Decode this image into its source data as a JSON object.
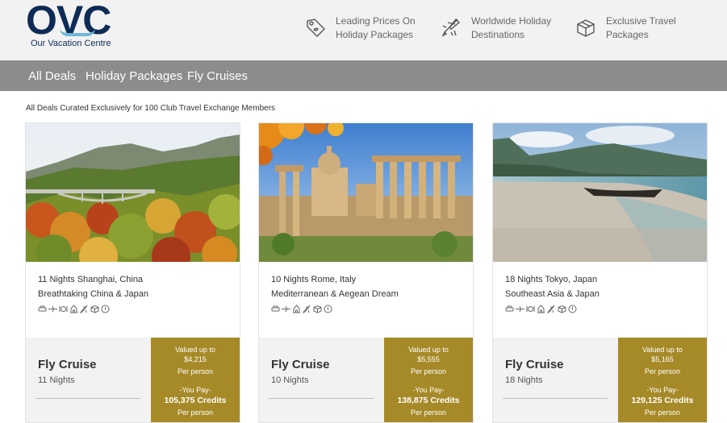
{
  "brand": {
    "logo_text": "OVC",
    "logo_subtitle": "Our Vacation Centre",
    "colors": {
      "navy": "#0d2b55",
      "accent": "#a68a28",
      "nav_bg": "#8c8c8c"
    }
  },
  "features": [
    {
      "icon": "price-tag-icon",
      "line1": "Leading Prices On",
      "line2": "Holiday Packages"
    },
    {
      "icon": "airplane-icon",
      "line1": "Worldwide Holiday",
      "line2": "Destinations"
    },
    {
      "icon": "gift-box-icon",
      "line1": "Exclusive Travel",
      "line2": "Packages"
    }
  ],
  "nav": {
    "items": [
      "All Deals",
      "Holiday Packages",
      "Fly Cruises"
    ]
  },
  "tagline": "All Deals Curated Exclusively for 100 Club Travel Exchange Members",
  "amenity_icons": [
    "car-icon",
    "plane-icon",
    "dining-icon",
    "hotel-icon",
    "flight-icon",
    "package-icon",
    "info-icon"
  ],
  "deals": [
    {
      "title": "11 Nights Shanghai, China",
      "subtitle": "Breathtaking China & Japan",
      "type": "Fly Cruise",
      "nights": "11 Nights",
      "valued_label": "Valued up to",
      "valued_amount": "$4,215",
      "per_person": "Per person",
      "you_pay_label": "-You Pay-",
      "credits": "105,375 Credits",
      "image": "autumn-gorge-bridge-photo"
    },
    {
      "title": "10 Nights Rome, Italy",
      "subtitle": "Mediterranean & Aegean Dream",
      "type": "Fly Cruise",
      "nights": "10 Nights",
      "valued_label": "Valued up to",
      "valued_amount": "$5,555",
      "per_person": "Per person",
      "you_pay_label": "-You Pay-",
      "credits": "138,875 Credits",
      "image": "roman-forum-ruins-photo"
    },
    {
      "title": "18 Nights Tokyo, Japan",
      "subtitle": "Southeast Asia & Japan",
      "type": "Fly Cruise",
      "nights": "18 Nights",
      "valued_label": "Valued up to",
      "valued_amount": "$5,165",
      "per_person": "Per person",
      "you_pay_label": "-You Pay-",
      "credits": "129,125 Credits",
      "image": "beach-boat-photo"
    }
  ]
}
